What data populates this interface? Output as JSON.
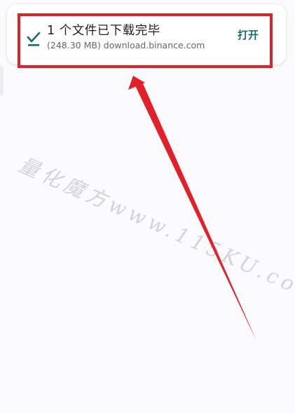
{
  "notification": {
    "title": "1 个文件已下载完毕",
    "subtitle": "(248.30 MB) download.binance.com",
    "action_label": "打开",
    "icon": "download-done-icon",
    "accent_color": "#1c6c68"
  },
  "watermark": {
    "text": "量化魔方www.115KU.com"
  },
  "annotation": {
    "color": "#e2202a"
  }
}
